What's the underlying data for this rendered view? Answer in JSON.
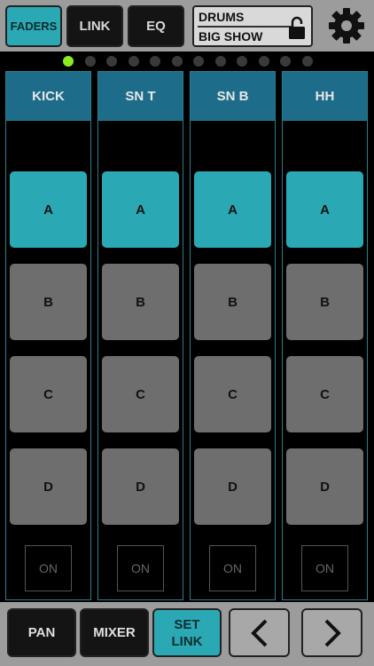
{
  "topbar": {
    "tabs": [
      {
        "label": "FADERS",
        "active": true
      },
      {
        "label": "LINK",
        "active": false
      },
      {
        "label": "EQ",
        "active": false
      }
    ],
    "scene": {
      "line1": "DRUMS",
      "line2": "BIG SHOW"
    },
    "icons": {
      "lock": "lock-icon",
      "settings": "gear-icon"
    }
  },
  "pager": {
    "total": 12,
    "active_index": 0
  },
  "strips": [
    {
      "name": "KICK",
      "pads": [
        "A",
        "B",
        "C",
        "D"
      ],
      "selected": "A",
      "on_label": "ON"
    },
    {
      "name": "SN T",
      "pads": [
        "A",
        "B",
        "C",
        "D"
      ],
      "selected": "A",
      "on_label": "ON"
    },
    {
      "name": "SN B",
      "pads": [
        "A",
        "B",
        "C",
        "D"
      ],
      "selected": "A",
      "on_label": "ON"
    },
    {
      "name": "HH",
      "pads": [
        "A",
        "B",
        "C",
        "D"
      ],
      "selected": "A",
      "on_label": "ON"
    }
  ],
  "bottombar": {
    "pan_label": "PAN",
    "mixer_label": "MIXER",
    "setlink_line1": "SET",
    "setlink_line2": "LINK",
    "prev_icon": "chevron-left-icon",
    "next_icon": "chevron-right-icon"
  },
  "colors": {
    "accent": "#2aa9b4",
    "header": "#1d6c8a",
    "pager_active": "#8bea20",
    "pad_inactive": "#6e6e6e"
  }
}
